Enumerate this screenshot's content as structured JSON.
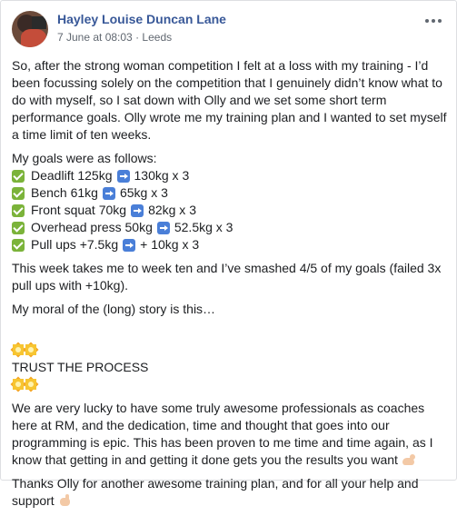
{
  "post": {
    "author": "Hayley Louise Duncan Lane",
    "date": "7 June at 08:03",
    "separator": "·",
    "location": "Leeds",
    "intro": "So, after the strong woman competition I felt at a loss with my training - I’d been focussing solely on the competition that I genuinely didn’t know what to do with myself, so I sat down with Olly and we set some short term performance goals. Olly wrote me my training plan and I wanted to set myself a time limit of ten weeks.",
    "goals_heading": "My goals were as follows:",
    "goals": [
      {
        "from": "Deadlift 125kg",
        "to": "130kg x 3"
      },
      {
        "from": "Bench 61kg",
        "to": "65kg x 3"
      },
      {
        "from": "Front squat 70kg",
        "to": "82kg x 3"
      },
      {
        "from": "Overhead press 50kg",
        "to": "52.5kg x 3"
      },
      {
        "from": "Pull ups +7.5kg",
        "to": "+ 10kg x 3"
      }
    ],
    "result": "This week takes me to week ten and I’ve smashed 4/5 of my goals (failed 3x pull ups with +10kg).",
    "moral": "My moral of the (long) story is this…",
    "trust": "TRUST THE PROCESS",
    "lucky": "We are very lucky to have some truly awesome professionals as coaches here at RM, and the dedication, time and thought that goes into our programming is epic. This has been proven to me time and time again, as I know that getting in and getting it done gets you the results you want",
    "thanks": "Thanks Olly for another awesome training plan, and for all your help and support"
  },
  "icons": {
    "check": "white-check-mark-icon",
    "arrow": "right-arrow-icon",
    "burst": "collision-icon",
    "flex": "flexed-biceps-icon",
    "point": "pointing-hand-icon",
    "globe": "globe-icon",
    "more": "more-options-icon"
  },
  "colors": {
    "author": "#385898",
    "meta": "#606770",
    "text": "#1c1e21",
    "check": "#7bb33a",
    "arrow": "#4a7fd8"
  }
}
